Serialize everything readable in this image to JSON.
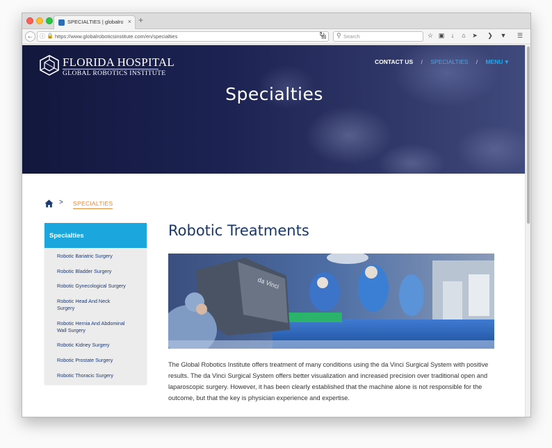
{
  "browser": {
    "tab_title": "SPECIALTIES | globalroboti...",
    "tab_close": "×",
    "new_tab": "+",
    "url": "https://www.globalroboticsinstitute.com/en/specialties",
    "search_placeholder": "Search"
  },
  "header": {
    "logo_title": "FLORIDA HOSPITAL",
    "logo_subtitle": "GLOBAL ROBOTICS INSTITUTE",
    "nav": {
      "contact": "CONTACT US",
      "separator": "/",
      "specialties": "SPECIALTIES",
      "menu": "MENU"
    },
    "hero_title": "Specialties"
  },
  "breadcrumb": {
    "separator": ">",
    "current": "SPECIALTIES"
  },
  "sidebar": {
    "heading": "Specialties",
    "items": [
      "Robotic Bariatric Surgery",
      "Robotic Bladder Surgery",
      "Robotic Gynecological Surgery",
      "Robotic Head And Neck Surgery",
      "Robotic Hernia And Abdominal Wall Surgery",
      "Robotic Kidney Surgery",
      "Robotic Prostate Surgery",
      "Robotic Thoracic Surgery"
    ]
  },
  "main": {
    "title": "Robotic Treatments",
    "photo_console_label": "da Vinci",
    "paragraph": "The Global Robotics Institute offers treatment of many conditions using the da Vinci Surgical System with positive results. The da Vinci Surgical System offers better visualization and increased precision over traditional open and laparoscopic surgery. However, it has been clearly established that the machine alone is not responsible for the outcome, but that the key is physician experience and expertise."
  },
  "colors": {
    "accent_blue": "#1ba6dd",
    "brand_navy": "#1b3869",
    "breadcrumb_orange": "#e2893a"
  },
  "icons": [
    "home-icon",
    "menu-caret-icon",
    "search-icon",
    "reload-icon",
    "back-icon",
    "bookmark-star-icon",
    "download-icon",
    "hamburger-icon"
  ]
}
